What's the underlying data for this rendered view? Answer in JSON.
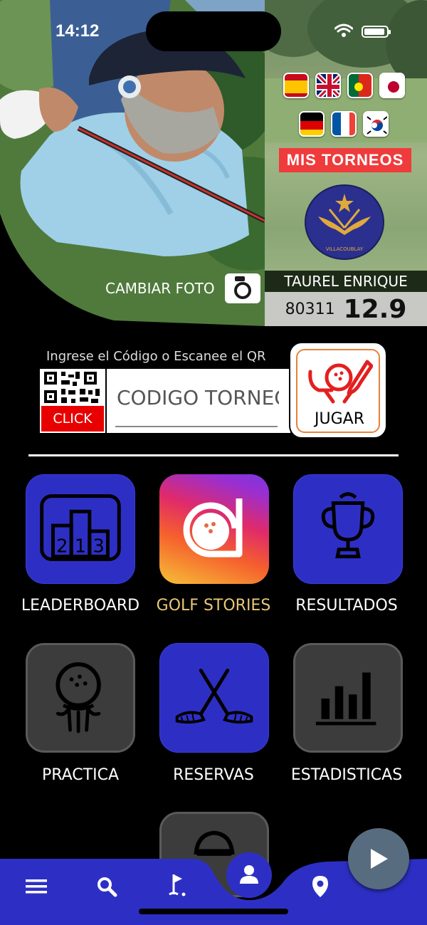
{
  "status_bar": {
    "time": "14:12",
    "wifi_icon": "wifi-icon",
    "battery_icon": "battery-full-icon"
  },
  "header": {
    "change_photo_label": "CAMBIAR FOTO",
    "camera_icon": "camera-icon",
    "languages": [
      "es",
      "en",
      "pt",
      "jp",
      "de",
      "fr",
      "kr"
    ],
    "my_tournaments_label": "MIS TORNEOS",
    "club_logo_text": "VILLACOUBLAY",
    "player_name": "TAUREL ENRIQUE",
    "player_id": "80311",
    "handicap": "12.9"
  },
  "entry": {
    "instruction": "Ingrese el Código o Escanee el QR",
    "click_label": "CLICK",
    "code_placeholder": "CODIGO TORNEO",
    "play_label": "JUGAR"
  },
  "menu": {
    "leaderboard": "LEADERBOARD",
    "leaderboard_digits": [
      "2",
      "1",
      "3"
    ],
    "golf_stories": "GOLF STORIES",
    "resultados": "RESULTADOS",
    "practica": "PRACTICA",
    "reservas": "RESERVAS",
    "estadisticas": "ESTADISTICAS"
  },
  "colors": {
    "accent_blue": "#2d2fc4",
    "red": "#ef3b3b",
    "gold": "#e7c878"
  },
  "bottom_nav": {
    "icons": [
      "menu-icon",
      "search-icon",
      "golf-flag-icon",
      "profile-icon",
      "location-pin-icon"
    ],
    "fab_icon": "play-icon"
  }
}
